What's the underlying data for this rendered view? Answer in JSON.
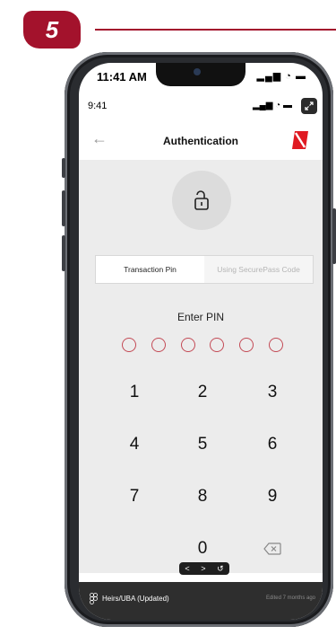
{
  "step_number": "5",
  "phone_status": {
    "time": "11:41 AM",
    "icons": "▂▄▆ ◔ ▬"
  },
  "app_status": {
    "time": "9:41",
    "icons": "▂▄▆ ◔ ▬"
  },
  "header": {
    "title": "Authentication",
    "back_icon": "←"
  },
  "tabs": [
    {
      "label": "Transaction Pin",
      "active": true
    },
    {
      "label": "Using SecurePass Code",
      "active": false
    }
  ],
  "pin": {
    "prompt": "Enter PIN",
    "length": 6,
    "filled": 0
  },
  "keypad": [
    "1",
    "2",
    "3",
    "4",
    "5",
    "6",
    "7",
    "8",
    "9",
    "0"
  ],
  "nav_widget": {
    "prev": "<",
    "next": ">",
    "reset": "↺"
  },
  "footer": {
    "title": "Heirs/UBA (Updated)",
    "meta": "Edited 7 months ago"
  },
  "colors": {
    "accent": "#a3122c",
    "pin_dot": "#c34a55",
    "logo_red": "#e01a22"
  }
}
